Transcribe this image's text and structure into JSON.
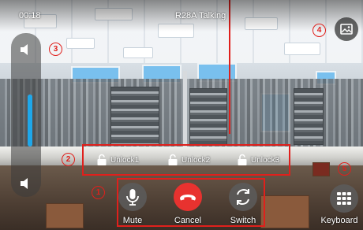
{
  "status": {
    "call_timer": "00:18",
    "device": "R28A",
    "state": "Talking"
  },
  "unlocks": [
    {
      "label": "Unlock1"
    },
    {
      "label": "Unlock2"
    },
    {
      "label": "Unlock3"
    }
  ],
  "controls": {
    "mute_label": "Mute",
    "cancel_label": "Cancel",
    "switch_label": "Switch",
    "keyboard_label": "Keyboard"
  },
  "annotations": [
    "1",
    "2",
    "3",
    "4",
    "5"
  ],
  "volume": {
    "level": 1.0
  },
  "colors": {
    "accent": "#1ea7ea",
    "cancel": "#e8322f",
    "annotation": "#e0201c",
    "control_bg": "#5c5c5c"
  },
  "icons": {
    "volume": "speaker-icon",
    "mute_side": "speaker-mute-icon",
    "snapshot": "image-capture-icon",
    "unlock": "padlock-icon",
    "mute": "microphone-icon",
    "cancel": "hangup-phone-icon",
    "switch": "switch-camera-icon",
    "keyboard": "keypad-icon"
  }
}
